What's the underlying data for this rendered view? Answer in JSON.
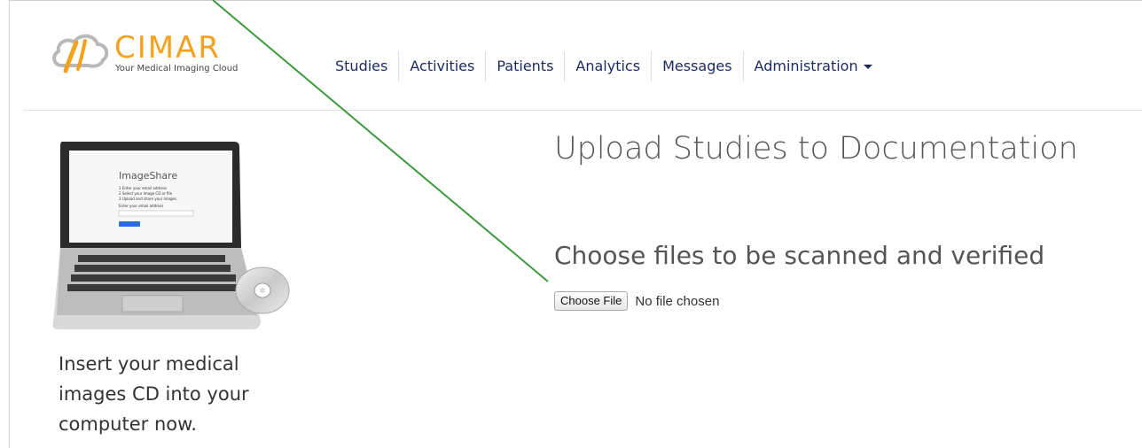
{
  "brand": {
    "name": "CIMAR",
    "tagline": "Your Medical Imaging Cloud",
    "accent_color": "#f4a21c",
    "icon": "cloud-logo-icon"
  },
  "nav": {
    "items": [
      {
        "label": "Studies"
      },
      {
        "label": "Activities"
      },
      {
        "label": "Patients"
      },
      {
        "label": "Analytics"
      },
      {
        "label": "Messages"
      },
      {
        "label": "Administration"
      }
    ],
    "text_color": "#1b2a5e"
  },
  "sidebar": {
    "illustration": {
      "icon": "laptop-with-cd-icon",
      "screen_title": "ImageShare",
      "screen_steps": [
        "1 Enter your email address",
        "2 Select your image CD or file",
        "3 Upload and share your images"
      ],
      "screen_prompt": "Enter your email address"
    },
    "instruction": "Insert your medical images CD into your computer now."
  },
  "main": {
    "title": "Upload Studies to Documentation",
    "subtitle": "Choose files to be scanned and verified",
    "file_input": {
      "button_label": "Choose File",
      "status": "No file chosen"
    }
  }
}
